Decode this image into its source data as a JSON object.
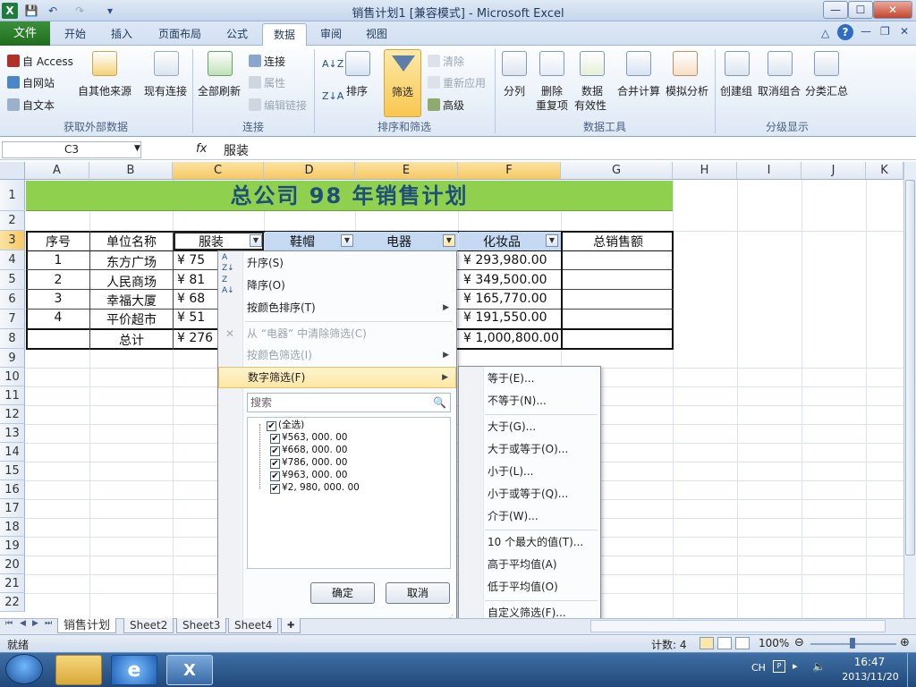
{
  "window": {
    "title": "销售计划1  [兼容模式]  -  Microsoft Excel",
    "min": "—",
    "max": "☐",
    "close": "✕",
    "doc_min": "—",
    "doc_restore": "❐",
    "doc_close": "✕"
  },
  "tabs": [
    "开始",
    "插入",
    "页面布局",
    "公式",
    "数据",
    "审阅",
    "视图"
  ],
  "file_tab": "文件",
  "ribbon": {
    "get_external": {
      "access": "自 Access",
      "web": "自网站",
      "text": "自文本",
      "other": "自其他来源",
      "existing": "现有连接",
      "label": "获取外部数据"
    },
    "connections": {
      "refresh_all": "全部刷新",
      "connections": "连接",
      "properties": "属性",
      "edit_links": "编辑链接",
      "label": "连接"
    },
    "sort_filter": {
      "sort": "排序",
      "filter": "筛选",
      "clear": "清除",
      "reapply": "重新应用",
      "advanced": "高级",
      "label": "排序和筛选"
    },
    "data_tools": {
      "text_to_columns": "分列",
      "remove_dup_1": "删除",
      "remove_dup_2": "重复项",
      "validation_1": "数据",
      "validation_2": "有效性",
      "consolidate": "合并计算",
      "whatif": "模拟分析",
      "label": "数据工具"
    },
    "outline": {
      "group": "创建组",
      "ungroup": "取消组合",
      "subtotal": "分类汇总",
      "label": "分级显示"
    }
  },
  "formula_bar": {
    "name_box": "C3",
    "fx": "fx",
    "content": "服装"
  },
  "columns": [
    "A",
    "B",
    "C",
    "D",
    "E",
    "F",
    "G",
    "H",
    "I",
    "J",
    "K"
  ],
  "rows": [
    "1",
    "2",
    "3",
    "4",
    "5",
    "6",
    "7",
    "8",
    "9",
    "10",
    "11",
    "12",
    "13",
    "14",
    "15",
    "16",
    "17",
    "18",
    "19",
    "20",
    "21",
    "22"
  ],
  "sheet": {
    "banner": "总公司 98 年销售计划",
    "headers": [
      "序号",
      "单位名称",
      "服装",
      "鞋帽",
      "电器",
      "化妆品",
      "总销售额"
    ],
    "data": [
      {
        "a": "1",
        "b": "东方广场",
        "c": "¥   75",
        "f": "¥      293,980.00"
      },
      {
        "a": "2",
        "b": "人民商场",
        "c": "¥   81",
        "f": "¥      349,500.00"
      },
      {
        "a": "3",
        "b": "幸福大厦",
        "c": "¥   68",
        "f": "¥      165,770.00"
      },
      {
        "a": "4",
        "b": "平价超市",
        "c": "¥   51",
        "f": "¥      191,550.00"
      }
    ],
    "total": {
      "b": "总计",
      "c": "¥ 276",
      "f": "¥   1,000,800.00"
    }
  },
  "filter_menu": {
    "sort_asc": "升序(S)",
    "sort_desc": "降序(O)",
    "sort_color": "按颜色排序(T)",
    "clear_filter": "从 “电器” 中清除筛选(C)",
    "filter_color": "按颜色筛选(I)",
    "number_filter": "数字筛选(F)",
    "search_placeholder": "搜索",
    "items": [
      "(全选)",
      "¥563, 000. 00",
      "¥668, 000. 00",
      "¥786, 000. 00",
      "¥963, 000. 00",
      "¥2, 980, 000. 00"
    ],
    "ok": "确定",
    "cancel": "取消"
  },
  "number_filter_submenu": [
    "等于(E)...",
    "不等于(N)...",
    "大于(G)...",
    "大于或等于(O)...",
    "小于(L)...",
    "小于或等于(Q)...",
    "介于(W)...",
    "10 个最大的值(T)...",
    "高于平均值(A)",
    "低于平均值(O)",
    "自定义筛选(F)..."
  ],
  "sheet_tabs": [
    "销售计划",
    "Sheet2",
    "Sheet3",
    "Sheet4"
  ],
  "status": {
    "ready": "就绪",
    "count": "计数: 4",
    "zoom": "100%"
  },
  "taskbar": {
    "lang": "CH",
    "time": "16:47",
    "date": "2013/11/20"
  },
  "colors": {
    "banner": "#8fd14f",
    "banner_text": "#1e4e79",
    "file_tab": "#2b7d2b",
    "highlight": "#fde7a4"
  },
  "icons": [
    "excel-icon",
    "save-icon",
    "undo-icon",
    "redo-icon",
    "filter-funnel-icon",
    "search-icon",
    "checkbox-icon",
    "windows-start-icon",
    "explorer-icon",
    "ie-icon",
    "excel-taskbar-icon"
  ]
}
